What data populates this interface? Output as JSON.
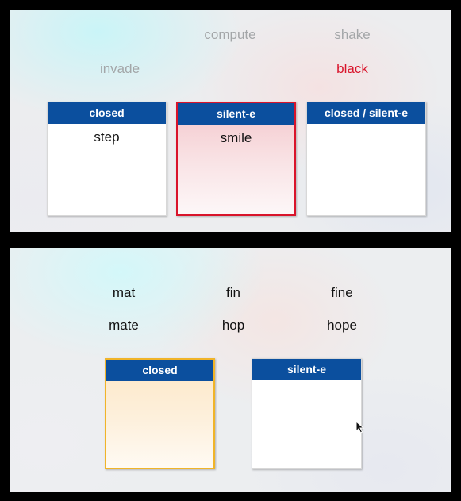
{
  "panel1": {
    "words": [
      {
        "text": "compute",
        "state": "faded"
      },
      {
        "text": "shake",
        "state": "faded"
      },
      {
        "text": "invade",
        "state": "faded"
      },
      {
        "text": "black",
        "state": "selected"
      }
    ],
    "boxes": [
      {
        "header": "closed",
        "items": [
          "step"
        ]
      },
      {
        "header": "silent-e",
        "items": [
          "smile"
        ]
      },
      {
        "header": "closed / silent-e",
        "items": []
      }
    ]
  },
  "panel2": {
    "words": [
      {
        "text": "mat"
      },
      {
        "text": "fin"
      },
      {
        "text": "fine"
      },
      {
        "text": "mate"
      },
      {
        "text": "hop"
      },
      {
        "text": "hope"
      }
    ],
    "boxes": [
      {
        "header": "closed",
        "items": []
      },
      {
        "header": "silent-e",
        "items": []
      }
    ]
  },
  "colors": {
    "header_blue": "#0b4f9e",
    "selected_red": "#d9142b",
    "active_yellow": "#f0b429",
    "faded_text": "#a3a6a8"
  }
}
